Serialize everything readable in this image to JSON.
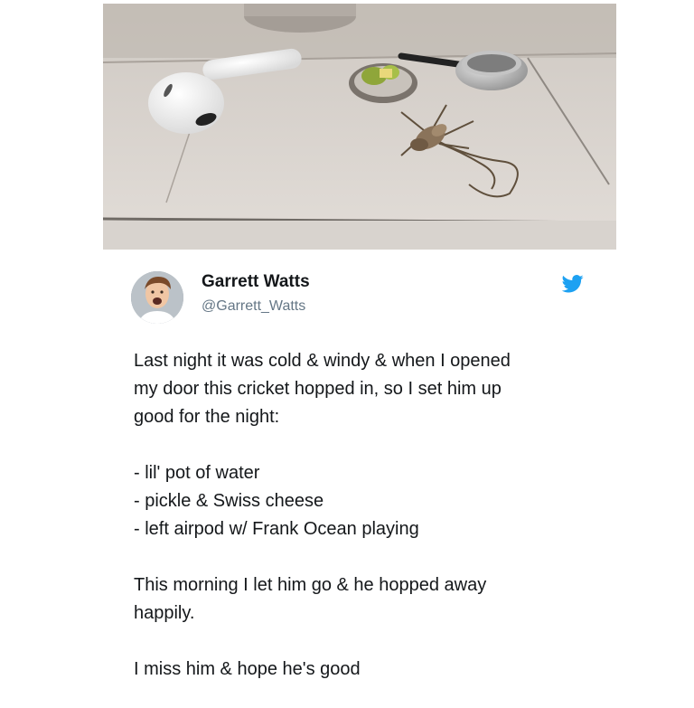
{
  "tweet": {
    "author_name": "Garrett Watts",
    "author_handle": "@Garrett_Watts",
    "avatar_icon": "avatar-photo",
    "brand_icon": "twitter-bird-icon",
    "brand_color": "#1da1f2",
    "lines": [
      "Last night it was cold & windy & when I opened",
      "my door this cricket hopped in, so I set him up",
      "good for the night:",
      "",
      "- lil' pot of water",
      "- pickle & Swiss cheese",
      "- left airpod w/ Frank Ocean playing",
      "",
      "This morning I let him go & he hopped away",
      "happily.",
      "",
      "I miss him & hope he's good"
    ]
  }
}
